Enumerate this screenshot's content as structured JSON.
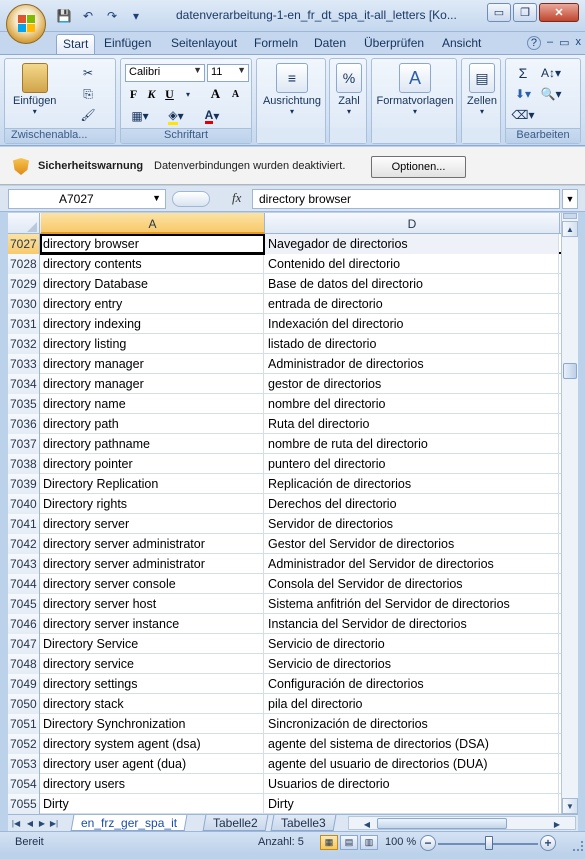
{
  "window": {
    "title": "datenverarbeitung-1-en_fr_dt_spa_it-all_letters  [Ko...",
    "minimize": "▭",
    "restore": "❐",
    "close": "✕"
  },
  "qat": {
    "save_icon": "save-icon",
    "undo_icon": "undo-icon",
    "redo_icon": "redo-icon",
    "customize_icon": "customize-icon"
  },
  "ribbon_tabs": [
    "Start",
    "Einfügen",
    "Seitenlayout",
    "Formeln",
    "Daten",
    "Überprüfen",
    "Ansicht"
  ],
  "ribbon_right": {
    "help": "?",
    "min": "–",
    "restore": "▭",
    "close": "x"
  },
  "ribbon": {
    "clipboard": {
      "paste": "Einfügen",
      "label": "Zwischenabla..."
    },
    "font": {
      "name": "Calibri",
      "size": "11",
      "label": "Schriftart",
      "bold": "F",
      "italic": "K",
      "underline": "U",
      "grow": "A",
      "shrink": "A",
      "font_color_letter": "A"
    },
    "alignment": {
      "label": "Ausrichtung"
    },
    "number": {
      "label": "Zahl",
      "percent": "%"
    },
    "styles": {
      "label": "Formatvorlagen"
    },
    "cells": {
      "label": "Zellen"
    },
    "editing": {
      "label": "Bearbeiten",
      "sum": "Σ"
    }
  },
  "security": {
    "title": "Sicherheitswarnung",
    "message": "Datenverbindungen wurden deaktiviert.",
    "button": "Optionen..."
  },
  "formula_bar": {
    "name_box": "A7027",
    "fx": "fx",
    "content": "directory browser"
  },
  "columns": [
    "A",
    "D"
  ],
  "rows": [
    {
      "n": "7027",
      "a": "directory browser",
      "d": "Navegador de directorios"
    },
    {
      "n": "7028",
      "a": "directory contents",
      "d": "Contenido del directorio"
    },
    {
      "n": "7029",
      "a": "directory Database",
      "d": "Base de datos del directorio"
    },
    {
      "n": "7030",
      "a": "directory entry",
      "d": "entrada de directorio"
    },
    {
      "n": "7031",
      "a": "directory indexing",
      "d": "Indexación del directorio"
    },
    {
      "n": "7032",
      "a": "directory listing",
      "d": "listado de directorio"
    },
    {
      "n": "7033",
      "a": "directory manager",
      "d": "Administrador de directorios"
    },
    {
      "n": "7034",
      "a": "directory manager",
      "d": "gestor de directorios"
    },
    {
      "n": "7035",
      "a": "directory name",
      "d": "nombre del directorio"
    },
    {
      "n": "7036",
      "a": "directory path",
      "d": "Ruta del directorio"
    },
    {
      "n": "7037",
      "a": "directory pathname",
      "d": "nombre de ruta del directorio"
    },
    {
      "n": "7038",
      "a": "directory pointer",
      "d": "puntero del directorio"
    },
    {
      "n": "7039",
      "a": "Directory Replication",
      "d": "Replicación de directorios"
    },
    {
      "n": "7040",
      "a": "Directory rights",
      "d": "Derechos del directorio"
    },
    {
      "n": "7041",
      "a": "directory server",
      "d": "Servidor de directorios"
    },
    {
      "n": "7042",
      "a": "directory server administrator",
      "d": "Gestor del Servidor de directorios"
    },
    {
      "n": "7043",
      "a": "directory server administrator",
      "d": "Administrador del Servidor de directorios"
    },
    {
      "n": "7044",
      "a": "directory server console",
      "d": "Consola del Servidor de directorios"
    },
    {
      "n": "7045",
      "a": "directory server host",
      "d": "Sistema anfitrión del Servidor de directorios"
    },
    {
      "n": "7046",
      "a": "directory server instance",
      "d": "Instancia del Servidor de directorios"
    },
    {
      "n": "7047",
      "a": "Directory Service",
      "d": "Servicio de directorio"
    },
    {
      "n": "7048",
      "a": "directory service",
      "d": "Servicio de directorios"
    },
    {
      "n": "7049",
      "a": "directory settings",
      "d": "Configuración de directorios"
    },
    {
      "n": "7050",
      "a": "directory stack",
      "d": "pila del directorio"
    },
    {
      "n": "7051",
      "a": "Directory Synchronization",
      "d": "Sincronización de directorios"
    },
    {
      "n": "7052",
      "a": "directory system agent (dsa)",
      "d": "agente del sistema de directorios (DSA)"
    },
    {
      "n": "7053",
      "a": "directory user agent (dua)",
      "d": "agente del usuario de directorios (DUA)"
    },
    {
      "n": "7054",
      "a": "directory users",
      "d": "Usuarios de directorio"
    },
    {
      "n": "7055",
      "a": "Dirty",
      "d": "Dirty"
    }
  ],
  "sheets": [
    "en_frz_ger_spa_it",
    "Tabelle2",
    "Tabelle3"
  ],
  "status": {
    "ready": "Bereit",
    "count": "Anzahl: 5",
    "zoom": "100 %",
    "zoom_minus": "−",
    "zoom_plus": "+"
  },
  "colors": {
    "accent": "#f8c96c",
    "ribbon": "#d3e1f3",
    "frame": "#bcd1ea"
  }
}
